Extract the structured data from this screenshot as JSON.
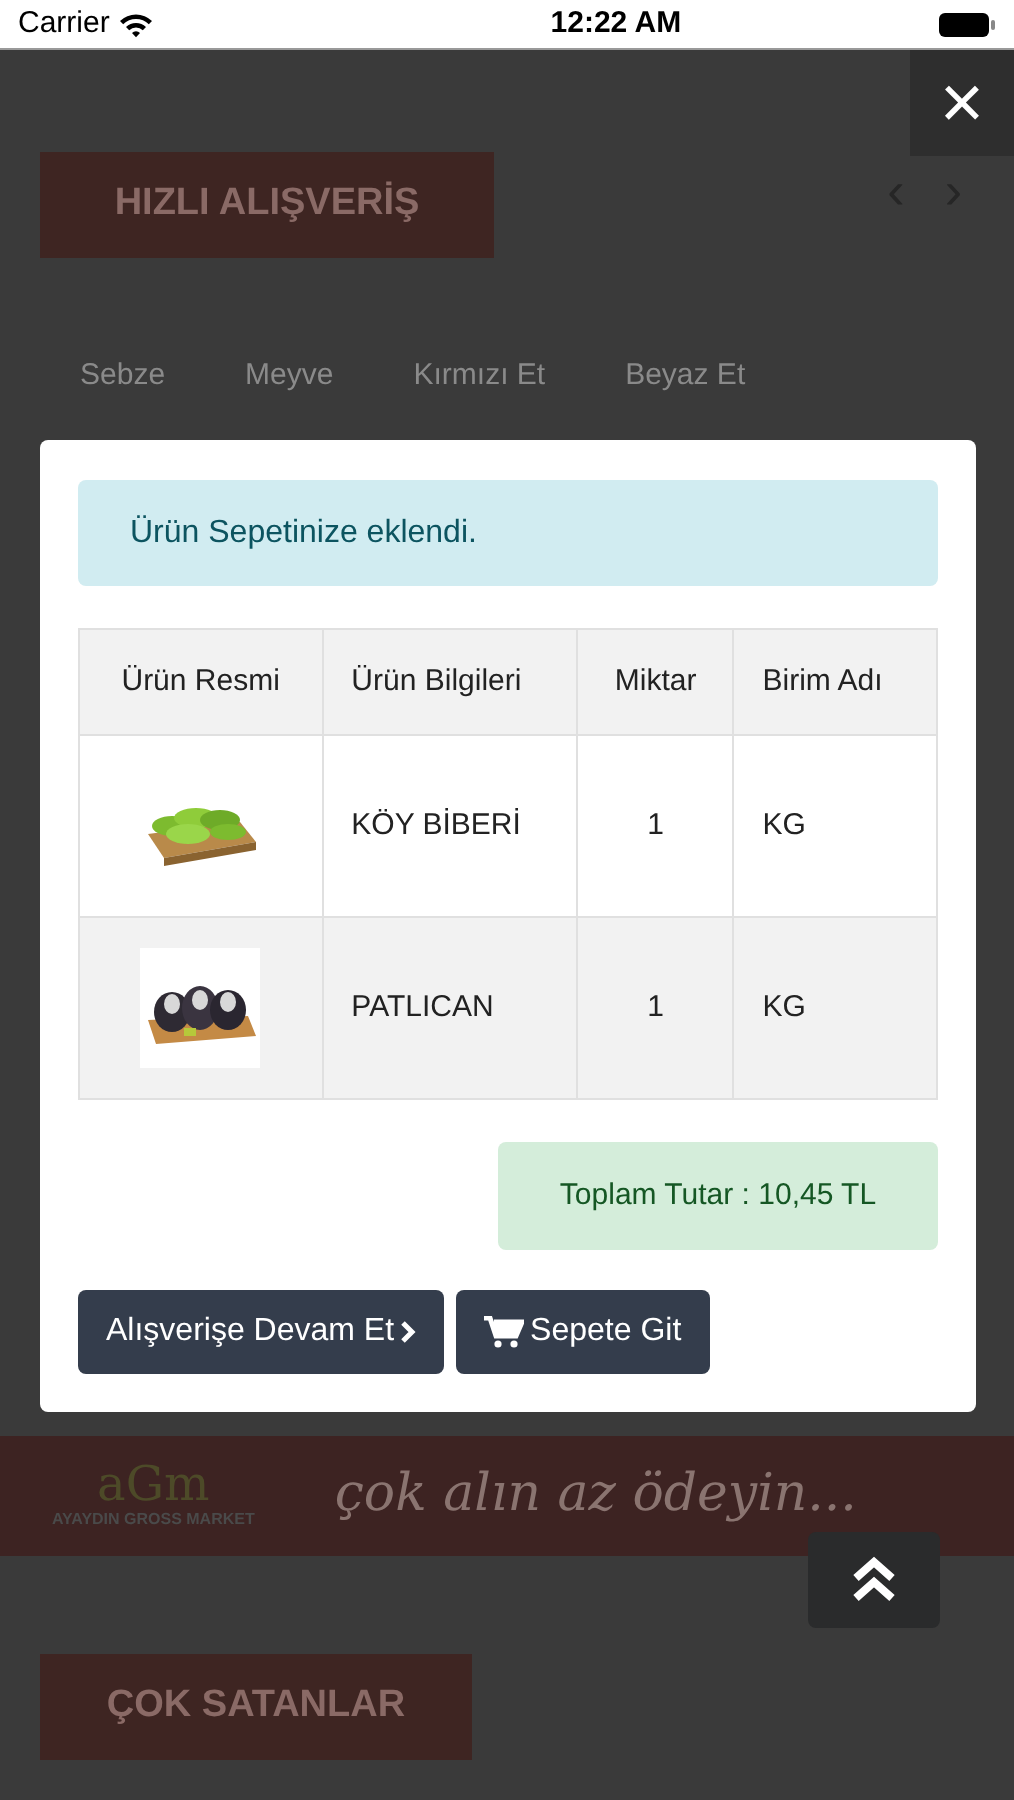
{
  "status_bar": {
    "carrier": "Carrier",
    "time": "12:22 AM"
  },
  "page": {
    "section_title": "HIZLI ALIŞVERİŞ",
    "prev": "‹",
    "next": "›",
    "tabs": [
      {
        "label": "Sebze"
      },
      {
        "label": "Meyve"
      },
      {
        "label": "Kırmızı Et"
      },
      {
        "label": "Beyaz Et"
      }
    ],
    "banner": {
      "logo_mark": "aGm",
      "logo_text": "AYAYDIN GROSS MARKET",
      "slogan": "çok alın az ödeyin..."
    },
    "section_title_2": "ÇOK SATANLAR"
  },
  "modal": {
    "close": "×",
    "alert": "Ürün Sepetinize eklendi.",
    "table": {
      "columns": [
        "Ürün Resmi",
        "Ürün Bilgileri",
        "Miktar",
        "Birim Adı"
      ],
      "rows": [
        {
          "product": "KÖY BİBERİ",
          "quantity": "1",
          "unit": "KG"
        },
        {
          "product": "PATLICAN",
          "quantity": "1",
          "unit": "KG"
        }
      ]
    },
    "total": "Toplam Tutar : 10,45 TL",
    "buttons": [
      {
        "label": "Alışverişe Devam Et",
        "kind": "continue"
      },
      {
        "label": "Sepete Git",
        "kind": "cart"
      }
    ]
  }
}
